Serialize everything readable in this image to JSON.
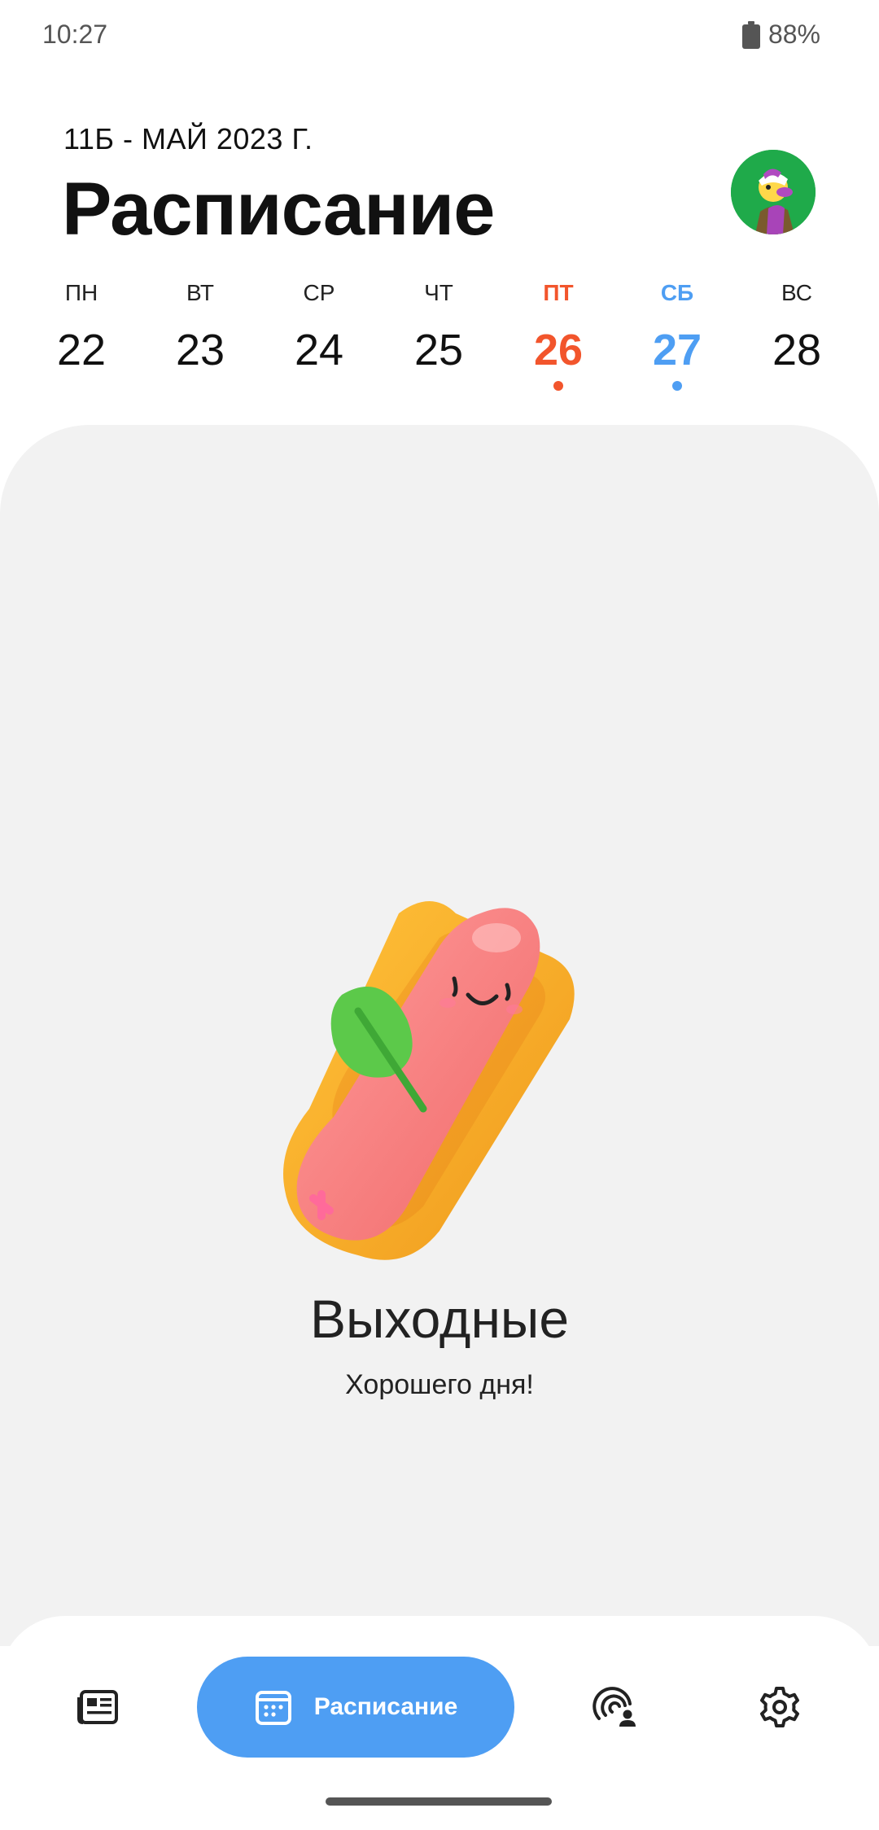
{
  "status_bar": {
    "time": "10:27",
    "battery": "88%"
  },
  "header": {
    "subtitle": "11Б - МАЙ 2023 Г.",
    "title": "Расписание"
  },
  "week": {
    "days": [
      {
        "name": "ПН",
        "num": "22"
      },
      {
        "name": "ВТ",
        "num": "23"
      },
      {
        "name": "СР",
        "num": "24"
      },
      {
        "name": "ЧТ",
        "num": "25"
      },
      {
        "name": "ПТ",
        "num": "26"
      },
      {
        "name": "СБ",
        "num": "27"
      },
      {
        "name": "ВС",
        "num": "28"
      }
    ]
  },
  "empty_state": {
    "title": "Выходные",
    "subtitle": "Хорошего дня!"
  },
  "bottom_nav": {
    "active_label": "Расписание"
  },
  "colors": {
    "accent": "#4e9ef3",
    "today": "#f2552c",
    "content_bg": "#f2f2f2"
  },
  "icons": [
    "battery-icon",
    "avatar",
    "hotdog-illustration",
    "news-icon",
    "calendar-icon",
    "grades-icon",
    "gear-icon"
  ]
}
